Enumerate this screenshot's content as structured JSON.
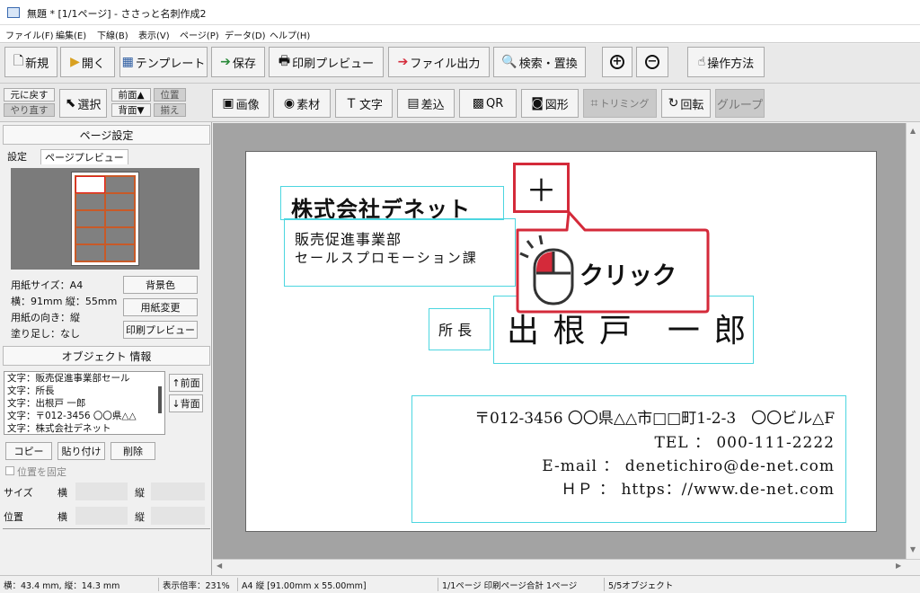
{
  "window": {
    "title": "無題 * [1/1ページ] - ささっと名刺作成2"
  },
  "menu": [
    "ファイル(F)",
    "編集(E)",
    "下線(B)",
    "表示(V)",
    "ページ(P)",
    "データ(D)",
    "ヘルプ(H)"
  ],
  "toolbar": {
    "new": "新規",
    "open": "開く",
    "template": "テンプレート",
    "save": "保存",
    "print_preview": "印刷プレビュー",
    "file_output": "ファイル出力",
    "search_replace": "検索・置換",
    "zoom_in": "+",
    "zoom_out": "−",
    "how_to": "操作方法"
  },
  "toolbar2": {
    "undo": "元に戻す",
    "redo": "やり直す",
    "select": "選択",
    "front": "前面▲",
    "back": "背面▼",
    "align1": "位置",
    "align2": "揃え",
    "image": "画像",
    "material": "素材",
    "text": "文字",
    "merge": "差込",
    "qr": "QR",
    "shape": "図形",
    "trim": "トリミング",
    "rotate": "回転",
    "group": "グループ"
  },
  "page_settings": {
    "header": "ページ設定",
    "tab_settings": "設定",
    "tab_preview": "ページプレビュー",
    "paper_size": "用紙サイズ：A4",
    "dims": "横：91mm 縦：55mm",
    "orientation": "用紙の向き：縦",
    "bleed": "塗り足し：なし",
    "bg_color": "背景色",
    "change_paper": "用紙変更",
    "print_preview": "印刷プレビュー"
  },
  "object_info": {
    "header": "オブジェクト 情報",
    "items": [
      "文字：販売促進事業部セール",
      "文字：所長",
      "文字：出根戸 一郎",
      "文字：〒012-3456 〇〇県△△",
      "文字：株式会社デネット"
    ],
    "front": "↑前面",
    "back": "↓背面",
    "copy": "コピー",
    "paste": "貼り付け",
    "delete": "削除",
    "lock": "位置を固定",
    "size": "サイズ",
    "pos": "位置",
    "w": "横",
    "h": "縦"
  },
  "card": {
    "company": "株式会社デネット",
    "dept1": "販売促進事業部",
    "dept2": "セールスプロモーション課",
    "title": "所 長",
    "name": "出 根 戸　一 郎",
    "address": "〒012-3456 〇〇県△△市□□町1-2-3　〇〇ビル△F",
    "tel": "TEL ： 000-111-2222",
    "email": "E-mail ： denetichiro@de-net.com",
    "hp": "ＨＰ ： https：//www.de-net.com"
  },
  "callout": {
    "plus": "＋",
    "click": "クリック"
  },
  "status": {
    "size": "横：43.4 mm, 縦：14.3 mm",
    "zoom": "表示倍率：231%",
    "paper": "A4 縦 [91.00mm x 55.00mm]",
    "pages": "1/1ページ 印刷ページ合計 1ページ",
    "objects": "5/5オブジェクト"
  },
  "colors": {
    "accent_red": "#d42a3a",
    "cyan_box": "#4cd6e0"
  }
}
